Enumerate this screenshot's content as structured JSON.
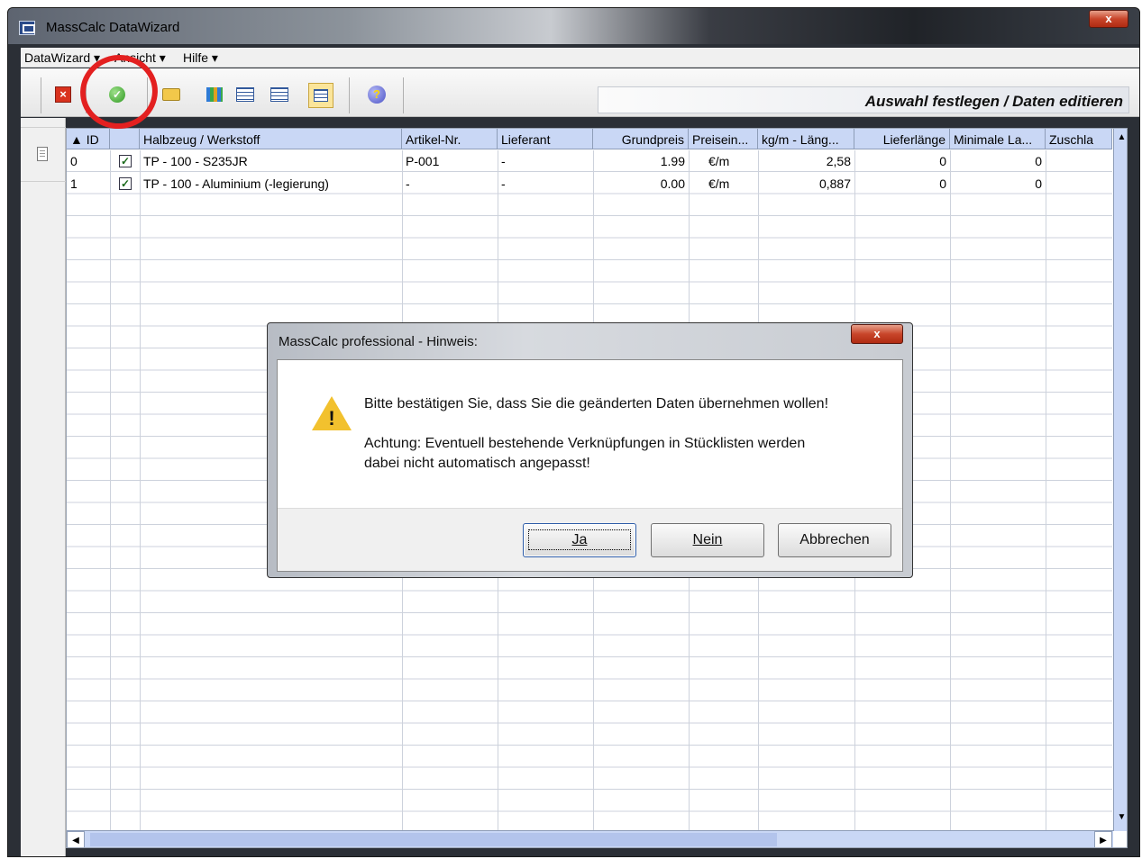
{
  "window": {
    "title": "MassCalc DataWizard",
    "close_glyph": "x"
  },
  "menu": [
    {
      "label": "DataWizard ▾"
    },
    {
      "label": "Ansicht ▾"
    },
    {
      "label": "Hilfe ▾"
    }
  ],
  "toolbar": {
    "header_text": "Auswahl festlegen / Daten editieren",
    "buttons": [
      "cancel-icon",
      "accept-icon",
      "open-folder-icon",
      "grid-colors-icon",
      "table-import-icon",
      "table-exchange-icon",
      "table-view-icon",
      "help-icon"
    ]
  },
  "grid": {
    "columns": [
      "▲ ID",
      "",
      "Halbzeug / Werkstoff",
      "Artikel-Nr.",
      "Lieferant",
      "Grundpreis",
      "Preisein...",
      "kg/m - Läng...",
      "Lieferlänge",
      "Minimale La...",
      "Zuschla"
    ],
    "rows": [
      {
        "id": "0",
        "checked": true,
        "material": "TP - 100 - S235JR",
        "article": "P-001",
        "supplier": "-",
        "price": "1.99",
        "unit": "€/m",
        "kgm": "2,58",
        "length": "0",
        "minlen": "0",
        "extra": ""
      },
      {
        "id": "1",
        "checked": true,
        "material": "TP - 100 - Aluminium (-legierung)",
        "article": "-",
        "supplier": "-",
        "price": "0.00",
        "unit": "€/m",
        "kgm": "0,887",
        "length": "0",
        "minlen": "0",
        "extra": ""
      }
    ]
  },
  "dialog": {
    "title": "MassCalc professional - Hinweis:",
    "message1": "Bitte bestätigen Sie, dass Sie die geänderten Daten übernehmen wollen!",
    "message2_line1": "Achtung: Eventuell bestehende Verknüpfungen in Stücklisten werden",
    "message2_line2": "dabei nicht automatisch angepasst!",
    "btn_yes": "Ja",
    "btn_no": "Nein",
    "btn_cancel": "Abbrechen",
    "close_glyph": "x"
  }
}
